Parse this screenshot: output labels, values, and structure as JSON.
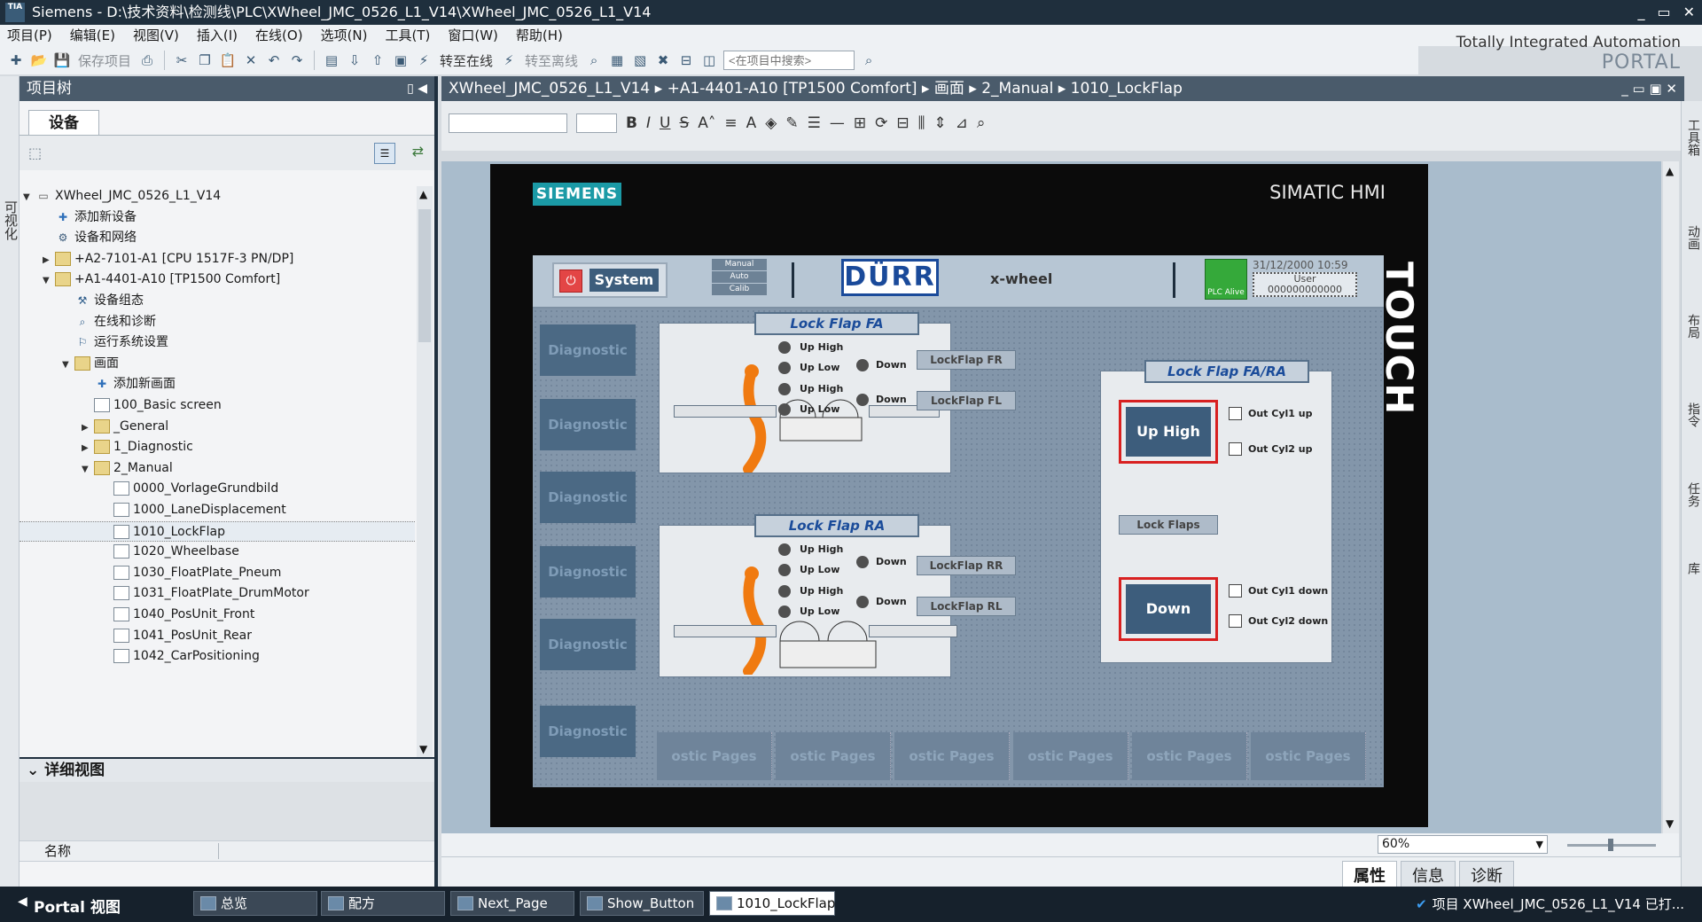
{
  "titlebar": {
    "logo": "TIA",
    "title": "Siemens  -  D:\\技术资料\\检测线\\PLC\\XWheel_JMC_0526_L1_V14\\XWheel_JMC_0526_L1_V14",
    "btn_min": "_",
    "btn_max": "▭",
    "btn_close": "✕"
  },
  "menu": [
    "项目(P)",
    "编辑(E)",
    "视图(V)",
    "插入(I)",
    "在线(O)",
    "选项(N)",
    "工具(T)",
    "窗口(W)",
    "帮助(H)"
  ],
  "brand": {
    "line1": "Totally Integrated Automation",
    "line2": "PORTAL"
  },
  "toolbar": {
    "save_label": "保存项目",
    "go_online": "转至在线",
    "go_offline": "转至离线",
    "search_placeholder": "<在项目中搜索>"
  },
  "leftpanel": {
    "vtab_label": "可视化",
    "title": "项目树",
    "devices_tab": "设备",
    "tree": [
      {
        "label": "XWheel_JMC_0526_L1_V14",
        "level": 0,
        "toggle": "▼",
        "icon": "project-icon"
      },
      {
        "label": "添加新设备",
        "level": 1,
        "toggle": "",
        "icon": "add-device-icon"
      },
      {
        "label": "设备和网络",
        "level": 1,
        "toggle": "",
        "icon": "network-icon"
      },
      {
        "label": "+A2-7101-A1 [CPU 1517F-3 PN/DP]",
        "level": 1,
        "toggle": "▶",
        "icon": "folder-icon"
      },
      {
        "label": "+A1-4401-A10 [TP1500 Comfort]",
        "level": 1,
        "toggle": "▼",
        "icon": "folder-icon"
      },
      {
        "label": "设备组态",
        "level": 2,
        "toggle": "",
        "icon": "config-icon"
      },
      {
        "label": "在线和诊断",
        "level": 2,
        "toggle": "",
        "icon": "diag-icon"
      },
      {
        "label": "运行系统设置",
        "level": 2,
        "toggle": "",
        "icon": "runtime-icon"
      },
      {
        "label": "画面",
        "level": 2,
        "toggle": "▼",
        "icon": "folder-icon"
      },
      {
        "label": "添加新画面",
        "level": 3,
        "toggle": "",
        "icon": "add-screen-icon"
      },
      {
        "label": "100_Basic screen",
        "level": 3,
        "toggle": "",
        "icon": "screen-icon"
      },
      {
        "label": "_General",
        "level": 3,
        "toggle": "▶",
        "icon": "folder-icon"
      },
      {
        "label": "1_Diagnostic",
        "level": 3,
        "toggle": "▶",
        "icon": "folder-icon"
      },
      {
        "label": "2_Manual",
        "level": 3,
        "toggle": "▼",
        "icon": "folder-icon"
      },
      {
        "label": "0000_VorlageGrundbild",
        "level": 4,
        "toggle": "",
        "icon": "screen-icon"
      },
      {
        "label": "1000_LaneDisplacement",
        "level": 4,
        "toggle": "",
        "icon": "screen-icon"
      },
      {
        "label": "1010_LockFlap",
        "level": 4,
        "toggle": "",
        "icon": "screen-icon",
        "selected": true
      },
      {
        "label": "1020_Wheelbase",
        "level": 4,
        "toggle": "",
        "icon": "screen-icon"
      },
      {
        "label": "1030_FloatPlate_Pneum",
        "level": 4,
        "toggle": "",
        "icon": "screen-icon"
      },
      {
        "label": "1031_FloatPlate_DrumMotor",
        "level": 4,
        "toggle": "",
        "icon": "screen-icon"
      },
      {
        "label": "1040_PosUnit_Front",
        "level": 4,
        "toggle": "",
        "icon": "screen-icon"
      },
      {
        "label": "1041_PosUnit_Rear",
        "level": 4,
        "toggle": "",
        "icon": "screen-icon"
      },
      {
        "label": "1042_CarPositioning",
        "level": 4,
        "toggle": "",
        "icon": "screen-icon"
      }
    ],
    "detail_title": "详细视图",
    "detail_col_name": "名称"
  },
  "editor": {
    "breadcrumb": "XWheel_JMC_0526_L1_V14  ▸  +A1-4401-A10 [TP1500 Comfort]  ▸  画面  ▸  2_Manual  ▸  1010_LockFlap",
    "zoom": "60%"
  },
  "hmi": {
    "siemens": "SIEMENS",
    "simatic": "SIMATIC HMI",
    "touch": "TOUCH",
    "system_btn": "System",
    "mode_manual": "Manual",
    "mode_auto": "Auto",
    "mode_calib": "Calib",
    "durr": "DÜRR",
    "xwheel": "x-wheel",
    "plc_alive": "PLC Alive",
    "datetime": "31/12/2000 10:59",
    "user": "User",
    "user_value": "000000000000",
    "diag_label": "Diagnostic",
    "lockflap_fa": "Lock Flap FA",
    "lockflap_ra": "Lock Flap RA",
    "lockflap_fara": "Lock Flap FA/RA",
    "up_high": "Up High",
    "up_low": "Up Low",
    "down": "Down",
    "btn_fr": "LockFlap FR",
    "btn_fl": "LockFlap FL",
    "btn_rr": "LockFlap RR",
    "btn_rl": "LockFlap RL",
    "big_up": "Up High",
    "big_down": "Down",
    "lock_flaps": "Lock Flaps",
    "out_cyl1_up": "Out Cyl1 up",
    "out_cyl2_up": "Out Cyl2 up",
    "out_cyl1_down": "Out Cyl1 down",
    "out_cyl2_down": "Out Cyl2 down",
    "page_tab": "ostic Pages"
  },
  "inspector": {
    "properties": "属性",
    "info": "信息",
    "diag": "诊断"
  },
  "rightstrip": [
    "工具箱",
    "动画",
    "布局",
    "指令",
    "任务",
    "库"
  ],
  "taskbar": {
    "portal_label": "Portal 视图",
    "tasks": [
      "总览",
      "配方",
      "Next_Page",
      "Show_Button",
      "1010_LockFlap"
    ],
    "status": "项目 XWheel_JMC_0526_L1_V14 已打..."
  }
}
